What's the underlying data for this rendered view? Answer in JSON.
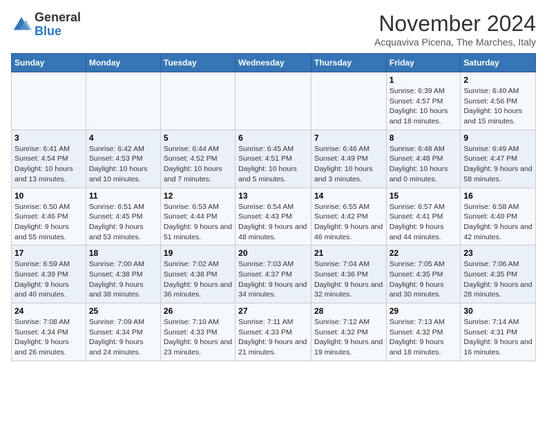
{
  "logo": {
    "general": "General",
    "blue": "Blue"
  },
  "calendar": {
    "title": "November 2024",
    "subtitle": "Acquaviva Picena, The Marches, Italy"
  },
  "headers": [
    "Sunday",
    "Monday",
    "Tuesday",
    "Wednesday",
    "Thursday",
    "Friday",
    "Saturday"
  ],
  "weeks": [
    [
      {
        "day": "",
        "info": ""
      },
      {
        "day": "",
        "info": ""
      },
      {
        "day": "",
        "info": ""
      },
      {
        "day": "",
        "info": ""
      },
      {
        "day": "",
        "info": ""
      },
      {
        "day": "1",
        "info": "Sunrise: 6:39 AM\nSunset: 4:57 PM\nDaylight: 10 hours and 18 minutes."
      },
      {
        "day": "2",
        "info": "Sunrise: 6:40 AM\nSunset: 4:56 PM\nDaylight: 10 hours and 15 minutes."
      }
    ],
    [
      {
        "day": "3",
        "info": "Sunrise: 6:41 AM\nSunset: 4:54 PM\nDaylight: 10 hours and 13 minutes."
      },
      {
        "day": "4",
        "info": "Sunrise: 6:42 AM\nSunset: 4:53 PM\nDaylight: 10 hours and 10 minutes."
      },
      {
        "day": "5",
        "info": "Sunrise: 6:44 AM\nSunset: 4:52 PM\nDaylight: 10 hours and 7 minutes."
      },
      {
        "day": "6",
        "info": "Sunrise: 6:45 AM\nSunset: 4:51 PM\nDaylight: 10 hours and 5 minutes."
      },
      {
        "day": "7",
        "info": "Sunrise: 6:46 AM\nSunset: 4:49 PM\nDaylight: 10 hours and 3 minutes."
      },
      {
        "day": "8",
        "info": "Sunrise: 6:48 AM\nSunset: 4:48 PM\nDaylight: 10 hours and 0 minutes."
      },
      {
        "day": "9",
        "info": "Sunrise: 6:49 AM\nSunset: 4:47 PM\nDaylight: 9 hours and 58 minutes."
      }
    ],
    [
      {
        "day": "10",
        "info": "Sunrise: 6:50 AM\nSunset: 4:46 PM\nDaylight: 9 hours and 55 minutes."
      },
      {
        "day": "11",
        "info": "Sunrise: 6:51 AM\nSunset: 4:45 PM\nDaylight: 9 hours and 53 minutes."
      },
      {
        "day": "12",
        "info": "Sunrise: 6:53 AM\nSunset: 4:44 PM\nDaylight: 9 hours and 51 minutes."
      },
      {
        "day": "13",
        "info": "Sunrise: 6:54 AM\nSunset: 4:43 PM\nDaylight: 9 hours and 48 minutes."
      },
      {
        "day": "14",
        "info": "Sunrise: 6:55 AM\nSunset: 4:42 PM\nDaylight: 9 hours and 46 minutes."
      },
      {
        "day": "15",
        "info": "Sunrise: 6:57 AM\nSunset: 4:41 PM\nDaylight: 9 hours and 44 minutes."
      },
      {
        "day": "16",
        "info": "Sunrise: 6:58 AM\nSunset: 4:40 PM\nDaylight: 9 hours and 42 minutes."
      }
    ],
    [
      {
        "day": "17",
        "info": "Sunrise: 6:59 AM\nSunset: 4:39 PM\nDaylight: 9 hours and 40 minutes."
      },
      {
        "day": "18",
        "info": "Sunrise: 7:00 AM\nSunset: 4:38 PM\nDaylight: 9 hours and 38 minutes."
      },
      {
        "day": "19",
        "info": "Sunrise: 7:02 AM\nSunset: 4:38 PM\nDaylight: 9 hours and 36 minutes."
      },
      {
        "day": "20",
        "info": "Sunrise: 7:03 AM\nSunset: 4:37 PM\nDaylight: 9 hours and 34 minutes."
      },
      {
        "day": "21",
        "info": "Sunrise: 7:04 AM\nSunset: 4:36 PM\nDaylight: 9 hours and 32 minutes."
      },
      {
        "day": "22",
        "info": "Sunrise: 7:05 AM\nSunset: 4:35 PM\nDaylight: 9 hours and 30 minutes."
      },
      {
        "day": "23",
        "info": "Sunrise: 7:06 AM\nSunset: 4:35 PM\nDaylight: 9 hours and 28 minutes."
      }
    ],
    [
      {
        "day": "24",
        "info": "Sunrise: 7:08 AM\nSunset: 4:34 PM\nDaylight: 9 hours and 26 minutes."
      },
      {
        "day": "25",
        "info": "Sunrise: 7:09 AM\nSunset: 4:34 PM\nDaylight: 9 hours and 24 minutes."
      },
      {
        "day": "26",
        "info": "Sunrise: 7:10 AM\nSunset: 4:33 PM\nDaylight: 9 hours and 23 minutes."
      },
      {
        "day": "27",
        "info": "Sunrise: 7:11 AM\nSunset: 4:33 PM\nDaylight: 9 hours and 21 minutes."
      },
      {
        "day": "28",
        "info": "Sunrise: 7:12 AM\nSunset: 4:32 PM\nDaylight: 9 hours and 19 minutes."
      },
      {
        "day": "29",
        "info": "Sunrise: 7:13 AM\nSunset: 4:32 PM\nDaylight: 9 hours and 18 minutes."
      },
      {
        "day": "30",
        "info": "Sunrise: 7:14 AM\nSunset: 4:31 PM\nDaylight: 9 hours and 16 minutes."
      }
    ]
  ]
}
